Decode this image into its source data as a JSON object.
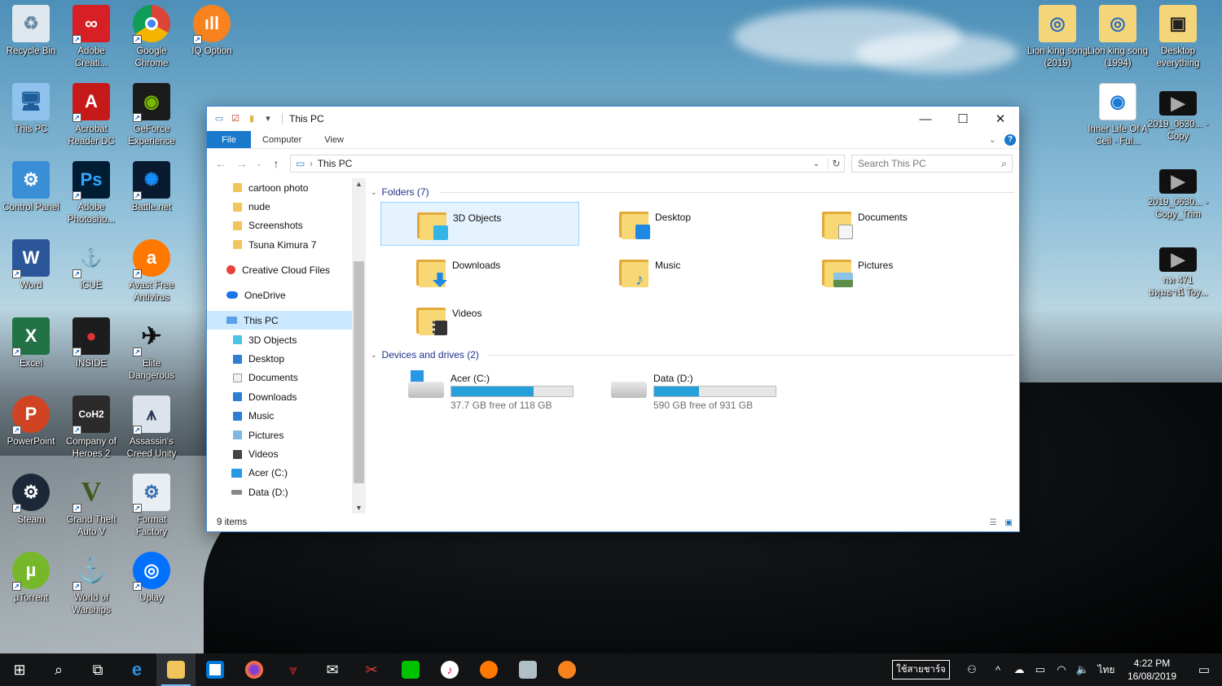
{
  "desktop_icons": [
    {
      "label": "Recycle Bin"
    },
    {
      "label": "Adobe Creati..."
    },
    {
      "label": "Google Chrome"
    },
    {
      "label": "IQ Option"
    },
    {
      "label": "This PC"
    },
    {
      "label": "Acrobat Reader DC"
    },
    {
      "label": "GeForce Experience"
    },
    {
      "label": "Control Panel"
    },
    {
      "label": "Adobe Photosho..."
    },
    {
      "label": "Battle.net"
    },
    {
      "label": "Word"
    },
    {
      "label": "iCUE"
    },
    {
      "label": "Avast Free Antivirus"
    },
    {
      "label": "Excel"
    },
    {
      "label": "INSIDE"
    },
    {
      "label": "Elite Dangerous"
    },
    {
      "label": "PowerPoint"
    },
    {
      "label": "Company of Heroes 2"
    },
    {
      "label": "Assassin's Creed Unity"
    },
    {
      "label": "Steam"
    },
    {
      "label": "Grand Theft Auto V"
    },
    {
      "label": "Format Factory"
    },
    {
      "label": "µTorrent"
    },
    {
      "label": "World of Warships"
    },
    {
      "label": "Uplay"
    },
    {
      "label": "Lion king song (2019)"
    },
    {
      "label": "Lion king song (1994)"
    },
    {
      "label": "Desktop everything"
    },
    {
      "label": "Inner Life Of A Cell - Ful..."
    },
    {
      "label": "2019_0630... - Copy"
    },
    {
      "label": "2019_0630... - Copy_Trim"
    },
    {
      "label": "กท 471 ปทุมธานี Toy..."
    }
  ],
  "window": {
    "title": "This PC",
    "buttons": {
      "minimize": "—",
      "maximize": "☐",
      "close": "✕"
    },
    "ribbon": {
      "file": "File",
      "computer": "Computer",
      "view": "View",
      "help": "?"
    },
    "address": {
      "location": "This PC"
    },
    "search": {
      "placeholder": "Search This PC"
    },
    "nav_pane": [
      {
        "label": "cartoon photo"
      },
      {
        "label": "nude"
      },
      {
        "label": "Screenshots"
      },
      {
        "label": "Tsuna Kimura 7"
      },
      {
        "label": "Creative Cloud Files"
      },
      {
        "label": "OneDrive"
      },
      {
        "label": "This PC"
      },
      {
        "label": "3D Objects"
      },
      {
        "label": "Desktop"
      },
      {
        "label": "Documents"
      },
      {
        "label": "Downloads"
      },
      {
        "label": "Music"
      },
      {
        "label": "Pictures"
      },
      {
        "label": "Videos"
      },
      {
        "label": "Acer (C:)"
      },
      {
        "label": "Data (D:)"
      }
    ],
    "folders_header": "Folders (7)",
    "folders": [
      {
        "name": "3D Objects"
      },
      {
        "name": "Desktop"
      },
      {
        "name": "Documents"
      },
      {
        "name": "Downloads"
      },
      {
        "name": "Music"
      },
      {
        "name": "Pictures"
      },
      {
        "name": "Videos"
      }
    ],
    "devices_header": "Devices and drives (2)",
    "drives": [
      {
        "name": "Acer (C:)",
        "free": "37.7 GB free of 118 GB",
        "used_fraction": 0.68
      },
      {
        "name": "Data (D:)",
        "free": "590 GB free of 931 GB",
        "used_fraction": 0.37
      }
    ],
    "status": "9 items"
  },
  "taskbar": {
    "ime_label": "ใช้สายชาร์จ",
    "language": "ไทย",
    "time": "4:22 PM",
    "date": "16/08/2019"
  },
  "colors": {
    "accent": "#1979ca",
    "selection": "#cce8ff",
    "drive_bar": "#26a0da"
  }
}
